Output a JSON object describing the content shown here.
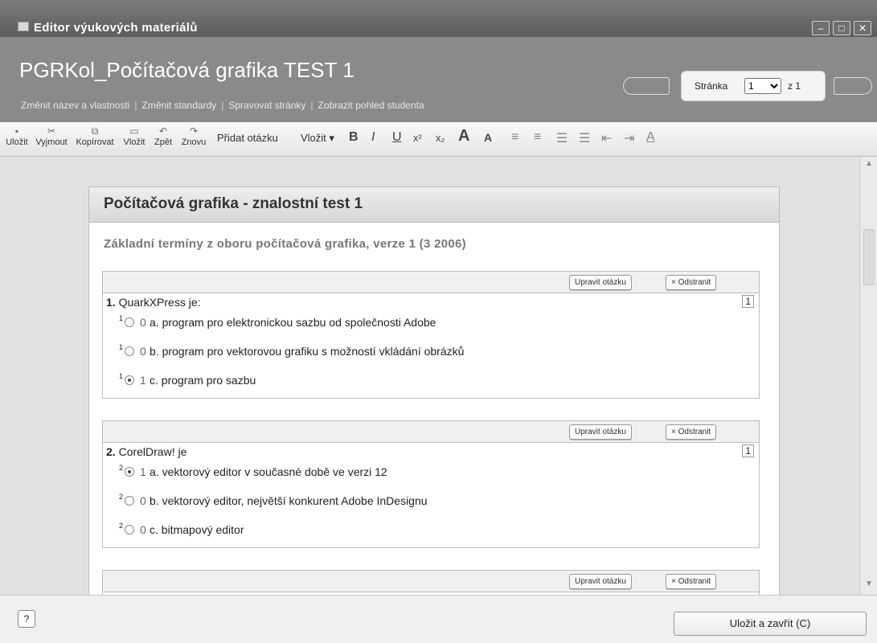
{
  "window": {
    "title": "Editor výukových materiálů",
    "controls": [
      "–",
      "□",
      "✕"
    ]
  },
  "header": {
    "doc_title": "PGRKol_Počítačová grafika TEST 1",
    "links": [
      "Změnit název a vlastnosti",
      "Změnit standardy",
      "Spravovat stránky",
      "Zobrazit pohled studenta"
    ],
    "pager": {
      "label": "Stránka",
      "current": "1",
      "total_text": "z 1"
    }
  },
  "toolbar": {
    "buttons": [
      "Uložit",
      "Vyjmout",
      "Kopírovat",
      "Vložit",
      "Zpět",
      "Znovu"
    ],
    "add_question": "Přidat otázku",
    "insert": "Vložit ▾",
    "format": [
      "B",
      "I",
      "U",
      "x²",
      "x₂",
      "A",
      "A"
    ]
  },
  "page": {
    "title": "Počítačová grafika - znalostní test 1",
    "subtitle": "Základní termíny z oboru počítačová grafika, verze 1 (3 2006)",
    "edit_label": "Upravit otázku",
    "remove_label": "× Odstranit",
    "questions": [
      {
        "number": "1.",
        "text": "QuarkXPress je:",
        "score": "1",
        "answers": [
          {
            "points": "0",
            "text": "a. program pro elektronickou sazbu od společnosti Adobe",
            "selected": false
          },
          {
            "points": "0",
            "text": "b. program pro vektorovou grafiku s možností vkládání obrázků",
            "selected": false
          },
          {
            "points": "1",
            "text": "c. program pro sazbu",
            "selected": true
          }
        ]
      },
      {
        "number": "2.",
        "text": "CorelDraw! je",
        "score": "1",
        "answers": [
          {
            "points": "1",
            "text": "a. vektorový editor v současné době ve verzi 12",
            "selected": true
          },
          {
            "points": "0",
            "text": "b. vektorový editor, největší konkurent Adobe InDesignu",
            "selected": false
          },
          {
            "points": "0",
            "text": "c. bitmapový editor",
            "selected": false
          }
        ]
      }
    ]
  },
  "footer": {
    "help": "?",
    "save_close": "Uložit a zavřít (C)"
  }
}
